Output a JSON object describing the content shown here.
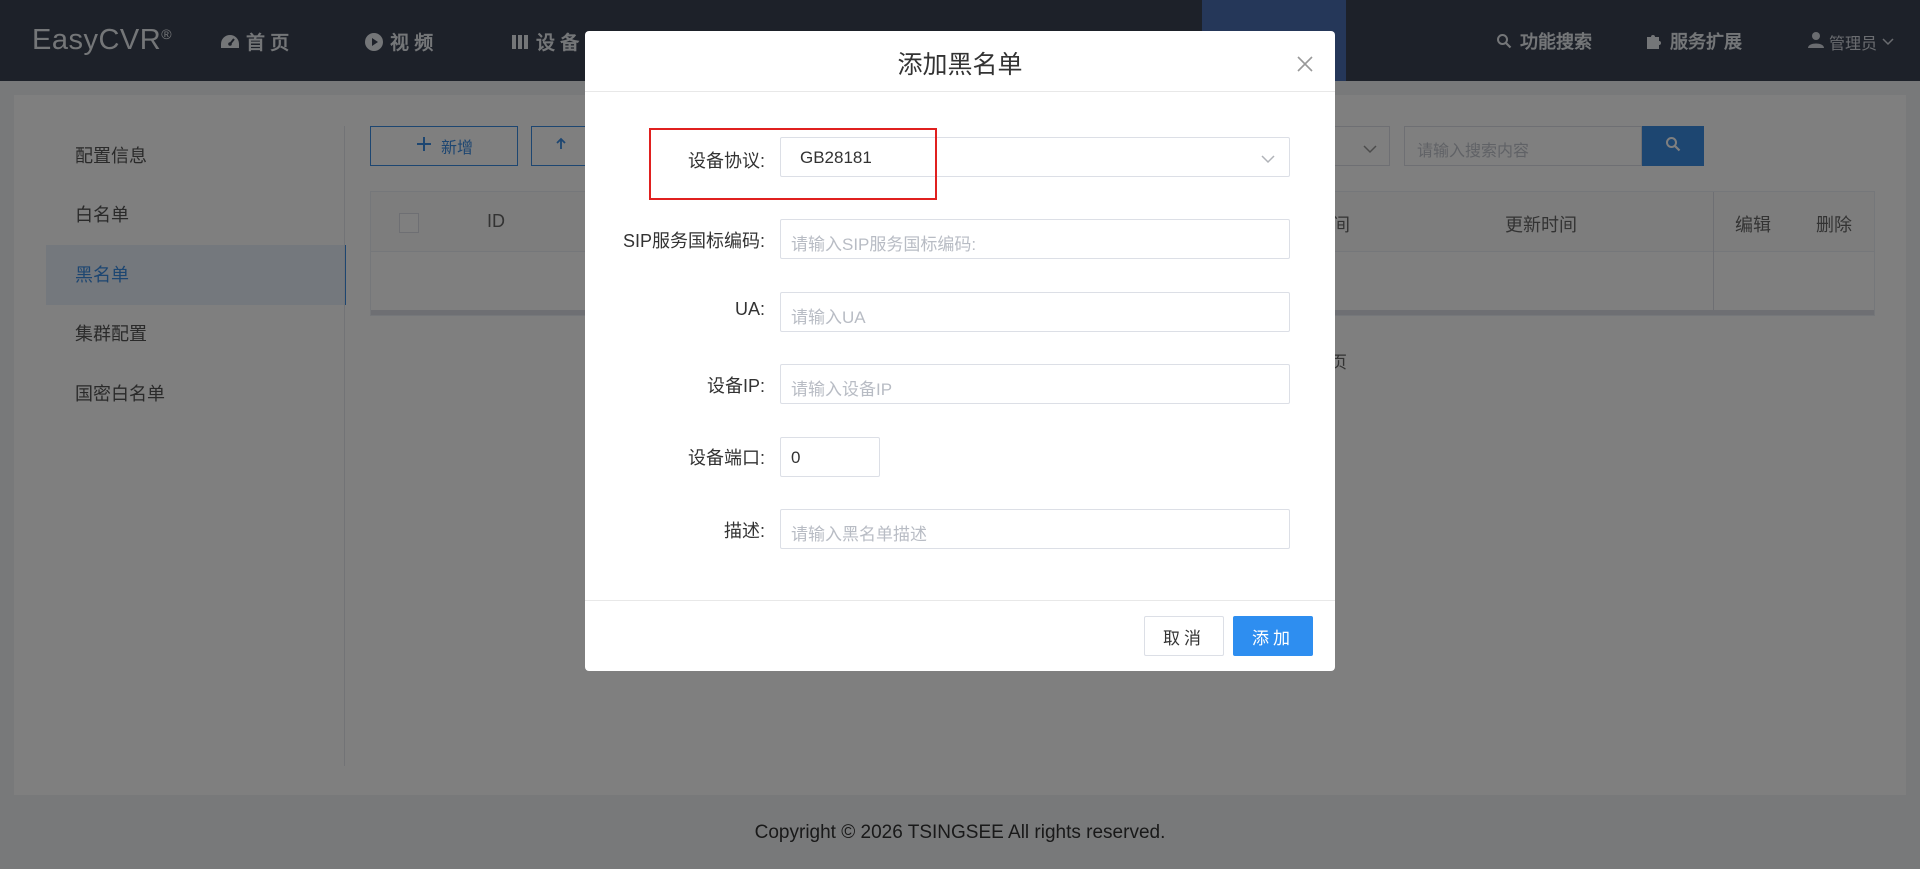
{
  "app": {
    "logo": "EasyCVR",
    "logo_mark": "®"
  },
  "nav": {
    "items": [
      {
        "label": "首 页",
        "icon": "dashboard-icon"
      },
      {
        "label": "视 频",
        "icon": "play-circle-icon"
      },
      {
        "label": "设 备",
        "icon": "columns-icon"
      }
    ],
    "search_label": "功能搜索",
    "extension_label": "服务扩展",
    "user_label": "管理员"
  },
  "sidebar": {
    "items": [
      {
        "label": "配置信息"
      },
      {
        "label": "白名单"
      },
      {
        "label": "黑名单",
        "active": true
      },
      {
        "label": "集群配置"
      },
      {
        "label": "国密白名单"
      }
    ]
  },
  "toolbar": {
    "add_label": "新增",
    "search_placeholder": "请输入搜索内容"
  },
  "table": {
    "columns": [
      "ID",
      "间",
      "更新时间",
      "编辑",
      "删除"
    ]
  },
  "pager_fragment": "页",
  "footer": {
    "copyright": "Copyright © 2026 TSINGSEE All rights reserved."
  },
  "modal": {
    "title": "添加黑名单",
    "fields": {
      "protocol": {
        "label": "设备协议:",
        "value": "GB28181"
      },
      "sip": {
        "label": "SIP服务国标编码:",
        "placeholder": "请输入SIP服务国标编码:"
      },
      "ua": {
        "label": "UA:",
        "placeholder": "请输入UA"
      },
      "ip": {
        "label": "设备IP:",
        "placeholder": "请输入设备IP"
      },
      "port": {
        "label": "设备端口:",
        "value": "0"
      },
      "desc": {
        "label": "描述:",
        "placeholder": "请输入黑名单描述"
      }
    },
    "cancel_label": "取消",
    "submit_label": "添加"
  },
  "colors": {
    "header_bg": "#3a4353",
    "accent": "#2e8ef0",
    "highlight_box": "#e0201f"
  }
}
